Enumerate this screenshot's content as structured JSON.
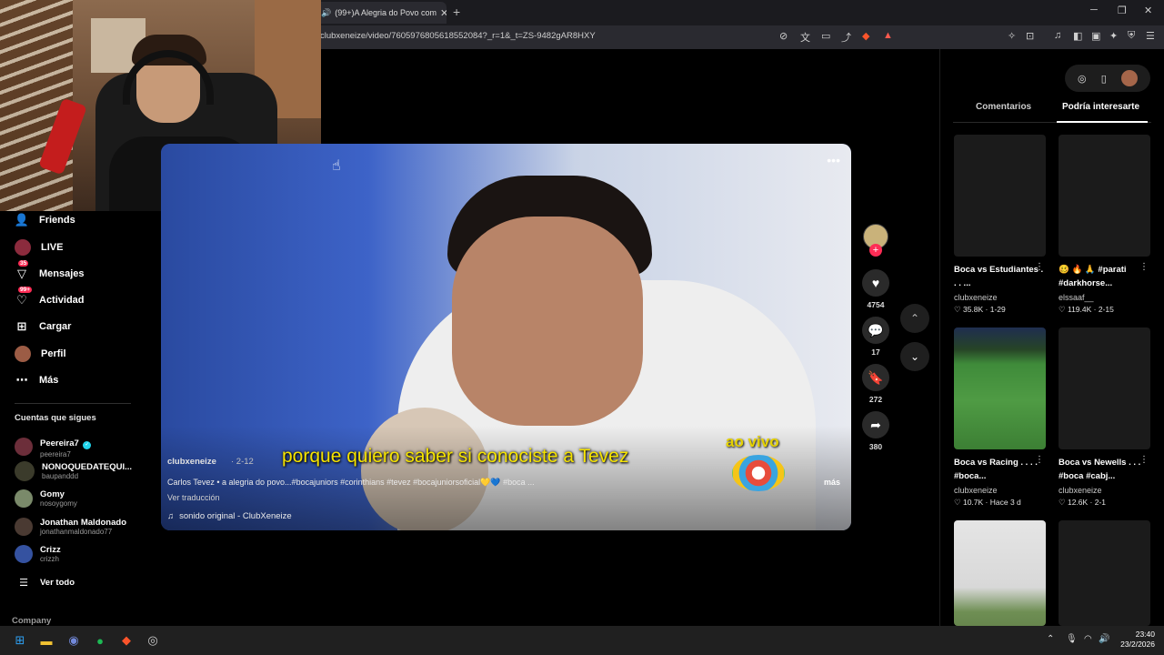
{
  "browser": {
    "tab_title": "(99+)A Alegria do Povo com",
    "url": "clubxeneize/video/7605976805618552084?_r=1&_t=ZS-9482gAR8HXY"
  },
  "sidebar": {
    "items": [
      {
        "label": "Friends",
        "icon": "friends-icon"
      },
      {
        "label": "LIVE",
        "icon": "live-icon"
      },
      {
        "label": "Mensajes",
        "icon": "messages-icon",
        "badge": "35"
      },
      {
        "label": "Actividad",
        "icon": "activity-icon",
        "badge": "99+"
      },
      {
        "label": "Cargar",
        "icon": "upload-icon"
      },
      {
        "label": "Perfil",
        "icon": "profile-icon"
      },
      {
        "label": "Más",
        "icon": "more-icon"
      }
    ],
    "following_title": "Cuentas que sigues",
    "accounts": [
      {
        "name": "Peereira7",
        "handle": "peereira7"
      },
      {
        "name": "NONOQUEDATEQUI...",
        "handle": "baupanddd"
      },
      {
        "name": "Gomy",
        "handle": "nosoygomy"
      },
      {
        "name": "Jonathan Maldonado",
        "handle": "jonathanmaldonado77"
      },
      {
        "name": "Crizz",
        "handle": "crizzh"
      }
    ],
    "see_all": "Ver todo",
    "company": "Company"
  },
  "video": {
    "subtitle": "porque quiero saber si conociste a Tevez",
    "overlay_text": "ao vivo",
    "author": "clubxeneize",
    "date": "· 2-12",
    "description": "Carlos Tevez • a alegria do povo...#bocajuniors #corinthians #tevez #bocajuniorsoficial💛💙 #boca ...",
    "more": "más",
    "translate": "Ver traducción",
    "sound": "sonido original - ClubXeneize"
  },
  "actions": {
    "likes": "4754",
    "comments": "17",
    "saves": "272",
    "shares": "380"
  },
  "right_panel": {
    "tab_comments": "Comentarios",
    "tab_suggest": "Podría interesarte",
    "cards": [
      {
        "title": "Boca vs Estudiantes . . . ...",
        "author": "clubxeneize",
        "stats": "♡ 35.8K · 1-29"
      },
      {
        "title": "🥴 🔥 🙏 #parati #darkhorse...",
        "author": "elssaaf__",
        "stats": "♡ 119.4K · 2-15"
      },
      {
        "title": "Boca vs Racing . . . . #boca...",
        "author": "clubxeneize",
        "stats": "♡ 10.7K · Hace 3 d"
      },
      {
        "title": "Boca vs Newells . . . #boca #cabj...",
        "author": "clubxeneize",
        "stats": "♡ 12.6K · 2-1"
      }
    ]
  },
  "taskbar": {
    "time": "23:40",
    "date": "23/2/2026"
  },
  "colors": {
    "accent": "#fe2c55",
    "subtitle": "#f5e300"
  }
}
